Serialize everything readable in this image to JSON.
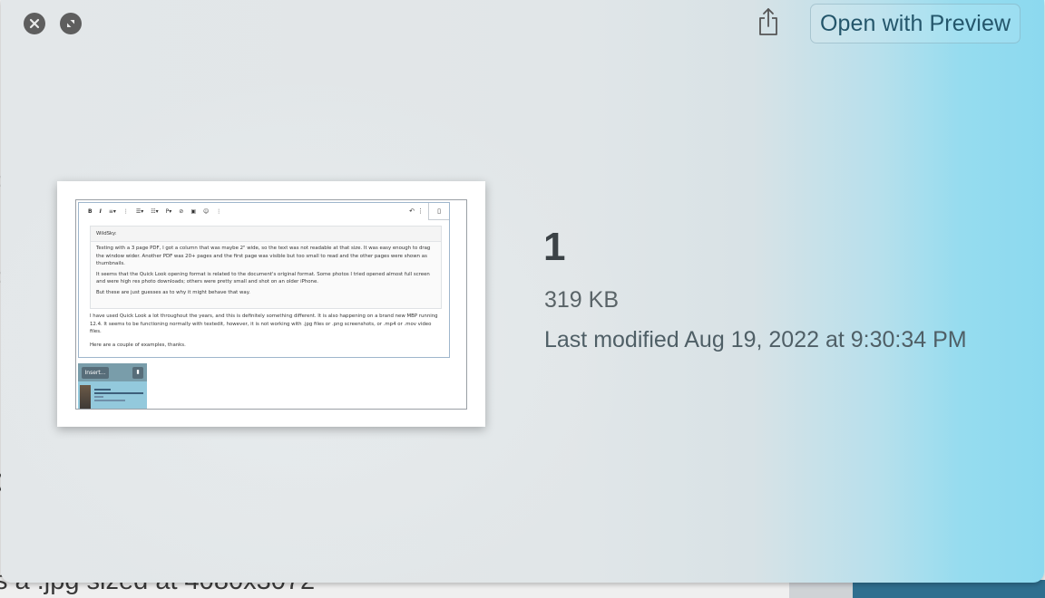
{
  "window": {
    "close_label": "Close",
    "fullscreen_label": "Full Screen",
    "share_label": "Share",
    "open_with_label": "Open with Preview"
  },
  "file": {
    "name": "1",
    "size": "319 KB",
    "modified": "Last modified Aug 19, 2022 at 9:30:34 PM"
  },
  "thumbnail": {
    "toolbar": [
      "B",
      "I",
      "≡▾",
      "⋮",
      "☰▾",
      "☷▾",
      "P▾",
      "⊘",
      "▣",
      "☺",
      "⋮"
    ],
    "toolbar_right": [
      "↶",
      "⋮"
    ],
    "quote_author": "WildSky:",
    "quote_paragraphs": [
      "Testing with a 3 page PDF, I got a column that was maybe 2\" wide, so the text was not readable at that size. It was easy enough to drag the window wider. Another PDF was 20+ pages and the first page was visible but too small to read and the other pages were shown as thumbnails.",
      "It seems that the Quick Look opening format is related to the document's original format. Some photos I tried opened almost full screen and were high res photo downloads; others were pretty small and shot on an older iPhone.",
      "But these are just guesses as to why it might behave that way."
    ],
    "reply_paragraphs": [
      "I have used Quick Look a lot throughout the years, and this is definitely something different. It is also happening on a brand new MBP running 12.4. It seems to be functioning normally with textedit, however, it is not working with .jpg files or .png screenshots, or .mp4 or .mov video files.",
      "Here are a couple of examples, thanks."
    ],
    "attachment_insert_label": "Insert..."
  },
  "background": {
    "bottom_text": "s a .jpg sized at 4080x3072"
  },
  "colors": {
    "accent": "#24566b",
    "panel_gradient_right": "#8cd9ef",
    "button_grey": "#5e5e5e"
  }
}
